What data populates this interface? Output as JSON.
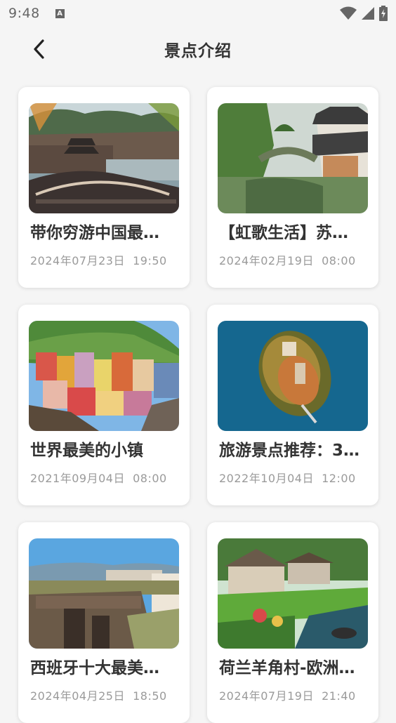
{
  "status_bar": {
    "time": "9:48",
    "a_icon_label": "A",
    "icons": [
      "a-icon",
      "wifi-icon",
      "signal-icon",
      "battery-icon"
    ]
  },
  "header": {
    "title": "景点介绍",
    "back_icon": "chevron-left-icon"
  },
  "cards": [
    {
      "title": "带你穷游中国最…",
      "date": "2024年07月23日  19:50",
      "image": "ancient-town-bridge"
    },
    {
      "title": "【虹歌生活】苏…",
      "date": "2024年02月19日  08:00",
      "image": "water-town-canal"
    },
    {
      "title": "世界最美的小镇",
      "date": "2021年09月04日  08:00",
      "image": "colorful-cliff-village"
    },
    {
      "title": "旅游景点推荐：3…",
      "date": "2022年10月04日  12:00",
      "image": "island-in-lake"
    },
    {
      "title": "西班牙十大最美…",
      "date": "2024年04月25日  18:50",
      "image": "gorge-bridge-town"
    },
    {
      "title": "荷兰羊角村-欧洲…",
      "date": "2024年07月19日  21:40",
      "image": "canal-village-houses"
    }
  ]
}
